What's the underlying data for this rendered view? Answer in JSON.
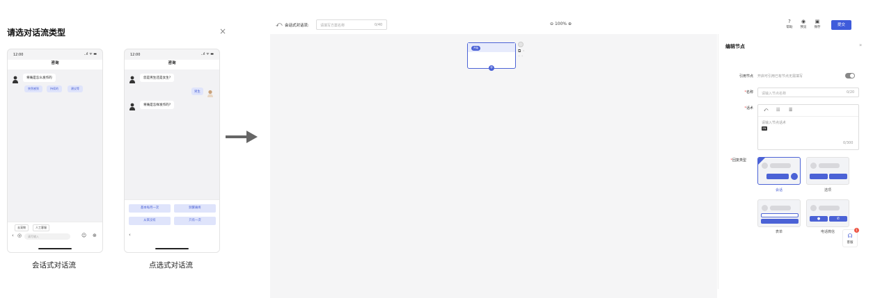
{
  "modal": {
    "title": "请选对话流类型",
    "close": "×",
    "captions": [
      "会话式对话流",
      "点选式对话流"
    ],
    "phone1": {
      "time": "12:00",
      "signal": "..ıl ᯤ ▬",
      "header": "咨询",
      "question": "将痛是怎么发作的",
      "chips": [
        "突然感到",
        "持续的",
        "建议等"
      ],
      "tabs": [
        "去宠物",
        "人工客服"
      ],
      "input_placeholder": "请写输入"
    },
    "phone2": {
      "time": "12:00",
      "signal": "..ıl ᯤ ▬",
      "header": "咨询",
      "question1": "您是男生还是女生?",
      "answer": "男生",
      "question2": "将痛是怎样发作的?",
      "options": [
        "基本每月一次",
        "频繁痛疼",
        "从来没有",
        "只有一次"
      ]
    }
  },
  "editor": {
    "topbar": {
      "label": "会话式对话流:",
      "input_placeholder": "请填写方案名称",
      "count": "0/40",
      "zoom": "100%",
      "tools": [
        {
          "icon": "?",
          "label": "帮助"
        },
        {
          "icon": "◉",
          "label": "预览"
        },
        {
          "icon": "▣",
          "label": "保存"
        }
      ],
      "submit": "提交"
    },
    "canvas": {
      "node_tag": "开始"
    },
    "panel": {
      "title": "编辑节点",
      "ref_label": "引用节点",
      "ref_hint": "开启可引用已有节点无需填写",
      "name_label": "名称",
      "name_placeholder": "请输入节点名称",
      "name_count": "0/20",
      "speech_label": "话术",
      "speech_placeholder": "请输入节点话术",
      "speech_en": "EN",
      "speech_count": "0/300",
      "reply_label": "回复类型",
      "reply_types": [
        "会话",
        "选项",
        "表单",
        "电话微信"
      ]
    },
    "service": {
      "label": "客服",
      "badge": "1"
    }
  }
}
